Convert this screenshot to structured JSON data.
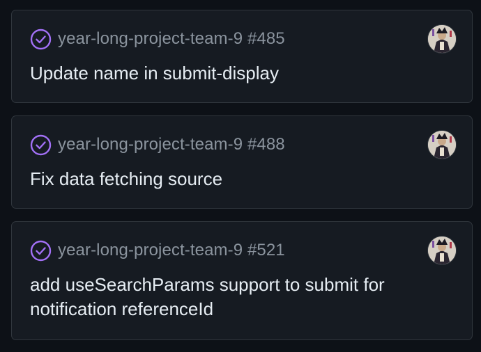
{
  "colors": {
    "background": "#0d1117",
    "card_background": "#161b22",
    "card_border": "#30363d",
    "merged_purple": "#a371f7",
    "muted_text": "#8b949e",
    "primary_text": "#e6edf3"
  },
  "items": [
    {
      "status_icon": "merged-check-circle-icon",
      "repo": "year-long-project-team-9",
      "number": "#485",
      "title": "Update name in submit-display",
      "avatar": "user-avatar"
    },
    {
      "status_icon": "merged-check-circle-icon",
      "repo": "year-long-project-team-9",
      "number": "#488",
      "title": "Fix data fetching source",
      "avatar": "user-avatar"
    },
    {
      "status_icon": "merged-check-circle-icon",
      "repo": "year-long-project-team-9",
      "number": "#521",
      "title": "add useSearchParams support to submit for notification referenceId",
      "avatar": "user-avatar"
    }
  ]
}
